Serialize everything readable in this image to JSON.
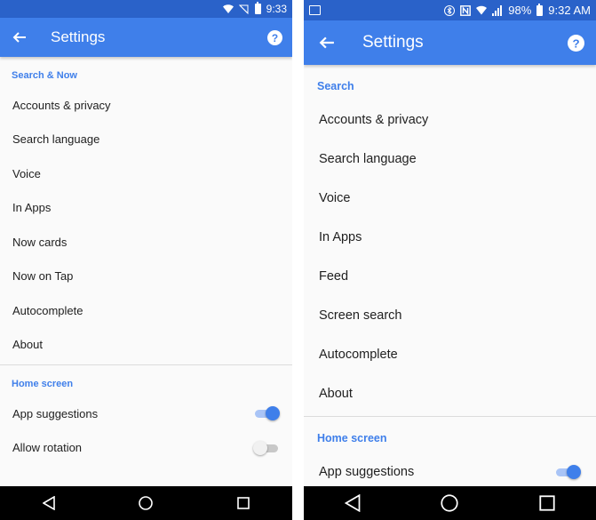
{
  "left": {
    "status": {
      "time": "9:33"
    },
    "appbar": {
      "title": "Settings",
      "back_icon": "arrow-back-icon",
      "help_icon": "help-circle-icon"
    },
    "sections": [
      {
        "header": "Search & Now",
        "items": [
          "Accounts & privacy",
          "Search language",
          "Voice",
          "In Apps",
          "Now cards",
          "Now on Tap",
          "Autocomplete",
          "About"
        ]
      },
      {
        "header": "Home screen",
        "toggles": [
          {
            "label": "App suggestions",
            "on": true
          },
          {
            "label": "Allow rotation",
            "on": false
          }
        ]
      }
    ]
  },
  "right": {
    "status": {
      "battery": "98%",
      "time": "9:32 AM"
    },
    "appbar": {
      "title": "Settings",
      "back_icon": "arrow-back-icon",
      "help_icon": "help-circle-icon"
    },
    "sections": [
      {
        "header": "Search",
        "items": [
          "Accounts & privacy",
          "Search language",
          "Voice",
          "In Apps",
          "Feed",
          "Screen search",
          "Autocomplete",
          "About"
        ]
      },
      {
        "header": "Home screen",
        "toggles": [
          {
            "label": "App suggestions",
            "on": true
          }
        ]
      }
    ]
  },
  "colors": {
    "status_bar": "#2a62c9",
    "app_bar": "#3f7fea",
    "accent": "#3f7fea",
    "background": "#fafafa",
    "nav_bar": "#000000"
  }
}
